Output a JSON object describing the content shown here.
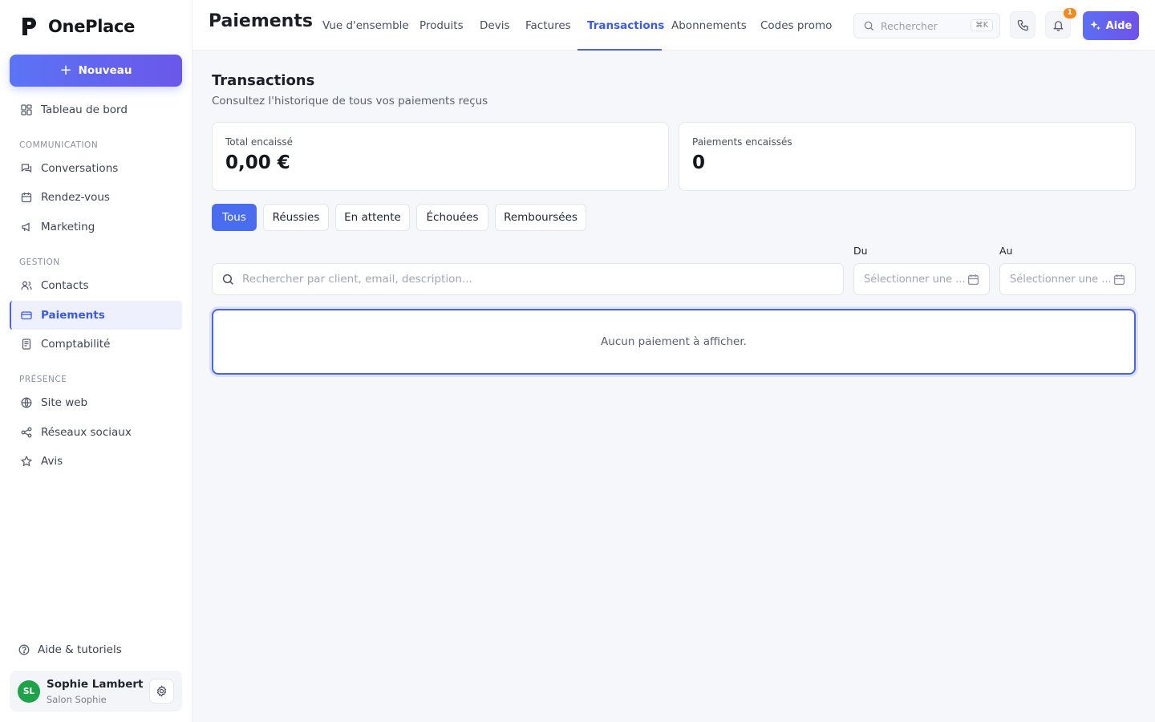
{
  "sidebar": {
    "brand": "OnePlace",
    "new_button": "Nouveau",
    "dashboard": "Tableau de bord",
    "sections": {
      "communication": "COMMUNICATION",
      "gestion": "GESTION",
      "presence": "PRÉSENCE"
    },
    "items": {
      "conversations": "Conversations",
      "rendez_vous": "Rendez-vous",
      "marketing": "Marketing",
      "contacts": "Contacts",
      "paiements": "Paiements",
      "comptabilite": "Comptabilité",
      "site_web": "Site web",
      "reseaux_sociaux": "Réseaux sociaux",
      "avis": "Avis"
    },
    "active_item": "Paiements",
    "help": "Aide & tutoriels",
    "user": {
      "initials": "SL",
      "name": "Sophie Lambert",
      "business": "Salon Sophie"
    }
  },
  "header": {
    "title": "Paiements",
    "tabs": {
      "overview": "Vue d'ensemble",
      "products": "Produits",
      "quotes": "Devis",
      "invoices": "Factures",
      "transactions": "Transactions",
      "subscriptions": "Abonnements",
      "promo_codes": "Codes promo"
    },
    "active_tab": "Transactions",
    "search_placeholder": "Rechercher",
    "search_shortcut": "⌘K",
    "notification_count": "1",
    "help_button": "Aide"
  },
  "main": {
    "title": "Transactions",
    "subtitle": "Consultez l'historique de tous vos paiements reçus",
    "stats": {
      "total_label": "Total encaissé",
      "total_value": "0,00 €",
      "count_label": "Paiements encaissés",
      "count_value": "0"
    },
    "filters": {
      "all": "Tous",
      "success": "Réussies",
      "pending": "En attente",
      "failed": "Échouées",
      "refunded": "Remboursées"
    },
    "active_filter": "Tous",
    "search_placeholder": "Rechercher par client, email, description...",
    "date_from_label": "Du",
    "date_to_label": "Au",
    "date_placeholder": "Sélectionner une ...",
    "empty_message": "Aucun paiement à afficher."
  },
  "colors": {
    "accent": "#4a64e8",
    "avatar": "#1fa34a",
    "badge": "#f08a1c"
  }
}
